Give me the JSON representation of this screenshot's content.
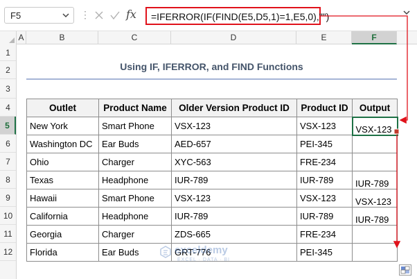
{
  "formula_bar": {
    "name_box": "F5",
    "formula": "=IFERROR(IF(FIND(E5,D5,1)=1,E5,0),\"\")"
  },
  "columns": [
    "A",
    "B",
    "C",
    "D",
    "E",
    "F"
  ],
  "rows": [
    "1",
    "2",
    "3",
    "4",
    "5",
    "6",
    "7",
    "8",
    "9",
    "10",
    "11",
    "12"
  ],
  "sheet": {
    "title": "Using IF, IFERROR, and FIND Functions",
    "headers": [
      "Outlet",
      "Product Name",
      "Older Version Product ID",
      "Product ID",
      "Output"
    ],
    "rows": [
      [
        "New York",
        "Smart Phone",
        "VSX-123",
        "VSX-123",
        "VSX-123"
      ],
      [
        "Washington DC",
        "Ear Buds",
        "AED-657",
        "PEI-345",
        ""
      ],
      [
        "Ohio",
        "Charger",
        "XYC-563",
        "FRE-234",
        ""
      ],
      [
        "Texas",
        "Headphone",
        "IUR-789",
        "IUR-789",
        "IUR-789"
      ],
      [
        "Hawaii",
        "Smart Phone",
        "VSX-123",
        "VSX-123",
        "VSX-123"
      ],
      [
        "California",
        "Headphone",
        "IUR-789",
        "IUR-789",
        "IUR-789"
      ],
      [
        "Georgia",
        "Charger",
        "ZDS-665",
        "FRE-234",
        ""
      ],
      [
        "Florida",
        "Ear Buds",
        "GRT-776",
        "PEI-345",
        ""
      ]
    ]
  },
  "watermark": {
    "name": "exceldemy",
    "tagline": "EXCEL · DATA · BI"
  },
  "colors": {
    "accent_red": "#e0121b",
    "selection_green": "#1e7145",
    "title_text": "#44546a"
  },
  "icons": [
    "chevron-down-icon",
    "cancel-icon",
    "enter-icon",
    "function-icon",
    "paste-options-icon"
  ]
}
